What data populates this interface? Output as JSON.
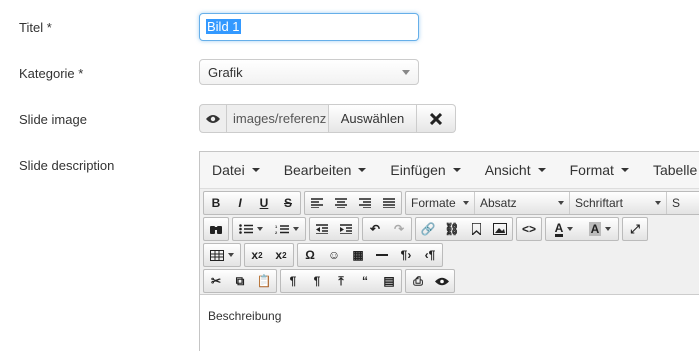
{
  "form": {
    "title_label": "Titel *",
    "title_value": "Bild 1",
    "category_label": "Kategorie *",
    "category_value": "Grafik",
    "slide_image_label": "Slide image",
    "slide_image_path": "images/referenz",
    "select_button": "Auswählen",
    "slide_description_label": "Slide description"
  },
  "editor": {
    "menu": [
      "Datei",
      "Bearbeiten",
      "Einfügen",
      "Ansicht",
      "Format",
      "Tabelle"
    ],
    "formats_label": "Formate",
    "paragraph_label": "Absatz",
    "font_label": "Schriftart",
    "size_label": "S",
    "content_text": "Beschreibung"
  }
}
